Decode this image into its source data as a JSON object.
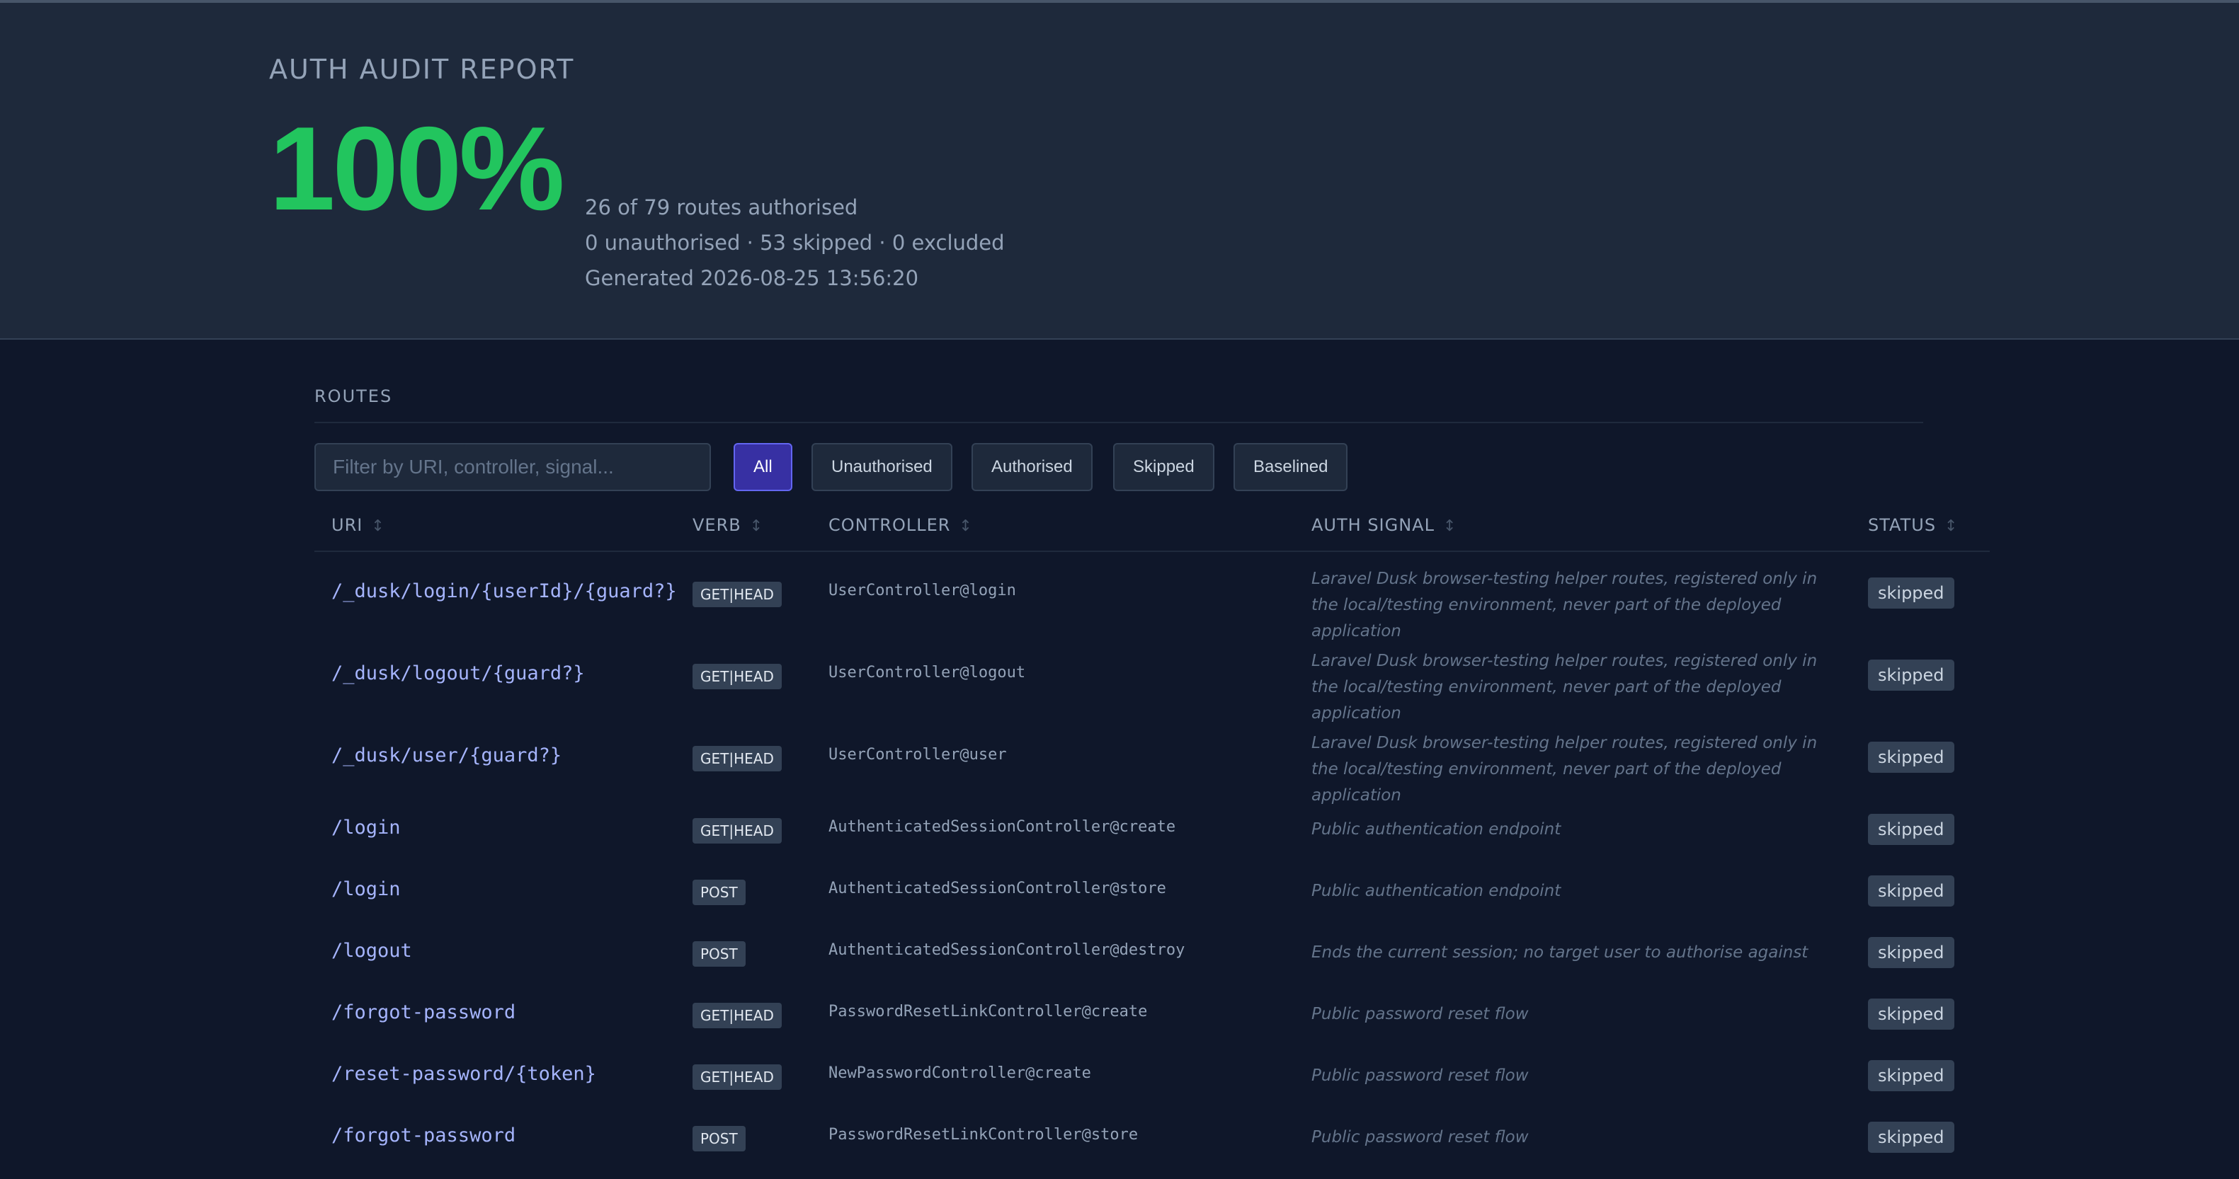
{
  "header": {
    "title": "AUTH AUDIT REPORT",
    "percentage": "100%",
    "summary_line1": "26 of 79 routes authorised",
    "summary_line2": "0 unauthorised · 53 skipped · 0 excluded",
    "generated": "Generated 2026-08-25 13:56:20"
  },
  "routes": {
    "section_label": "ROUTES",
    "filter_placeholder": "Filter by URI, controller, signal...",
    "filters": [
      "All",
      "Unauthorised",
      "Authorised",
      "Skipped",
      "Baselined"
    ],
    "active_filter": "All",
    "columns": [
      "URI",
      "VERB",
      "CONTROLLER",
      "AUTH SIGNAL",
      "STATUS"
    ],
    "rows": [
      {
        "uri": "/_dusk/login/{userId}/{guard?}",
        "verb": "GET|HEAD",
        "controller": "UserController@login",
        "signal": "Laravel Dusk browser-testing helper routes, registered only in the local/testing environment, never part of the deployed application",
        "status": "skipped"
      },
      {
        "uri": "/_dusk/logout/{guard?}",
        "verb": "GET|HEAD",
        "controller": "UserController@logout",
        "signal": "Laravel Dusk browser-testing helper routes, registered only in the local/testing environment, never part of the deployed application",
        "status": "skipped"
      },
      {
        "uri": "/_dusk/user/{guard?}",
        "verb": "GET|HEAD",
        "controller": "UserController@user",
        "signal": "Laravel Dusk browser-testing helper routes, registered only in the local/testing environment, never part of the deployed application",
        "status": "skipped"
      },
      {
        "uri": "/login",
        "verb": "GET|HEAD",
        "controller": "AuthenticatedSessionController@create",
        "signal": "Public authentication endpoint",
        "status": "skipped"
      },
      {
        "uri": "/login",
        "verb": "POST",
        "controller": "AuthenticatedSessionController@store",
        "signal": "Public authentication endpoint",
        "status": "skipped"
      },
      {
        "uri": "/logout",
        "verb": "POST",
        "controller": "AuthenticatedSessionController@destroy",
        "signal": "Ends the current session; no target user to authorise against",
        "status": "skipped"
      },
      {
        "uri": "/forgot-password",
        "verb": "GET|HEAD",
        "controller": "PasswordResetLinkController@create",
        "signal": "Public password reset flow",
        "status": "skipped"
      },
      {
        "uri": "/reset-password/{token}",
        "verb": "GET|HEAD",
        "controller": "NewPasswordController@create",
        "signal": "Public password reset flow",
        "status": "skipped"
      },
      {
        "uri": "/forgot-password",
        "verb": "POST",
        "controller": "PasswordResetLinkController@store",
        "signal": "Public password reset flow",
        "status": "skipped"
      }
    ]
  },
  "colors": {
    "accent_green": "#22c55e",
    "active_filter": "#3730a3",
    "uri_link": "#a5b4fc"
  }
}
